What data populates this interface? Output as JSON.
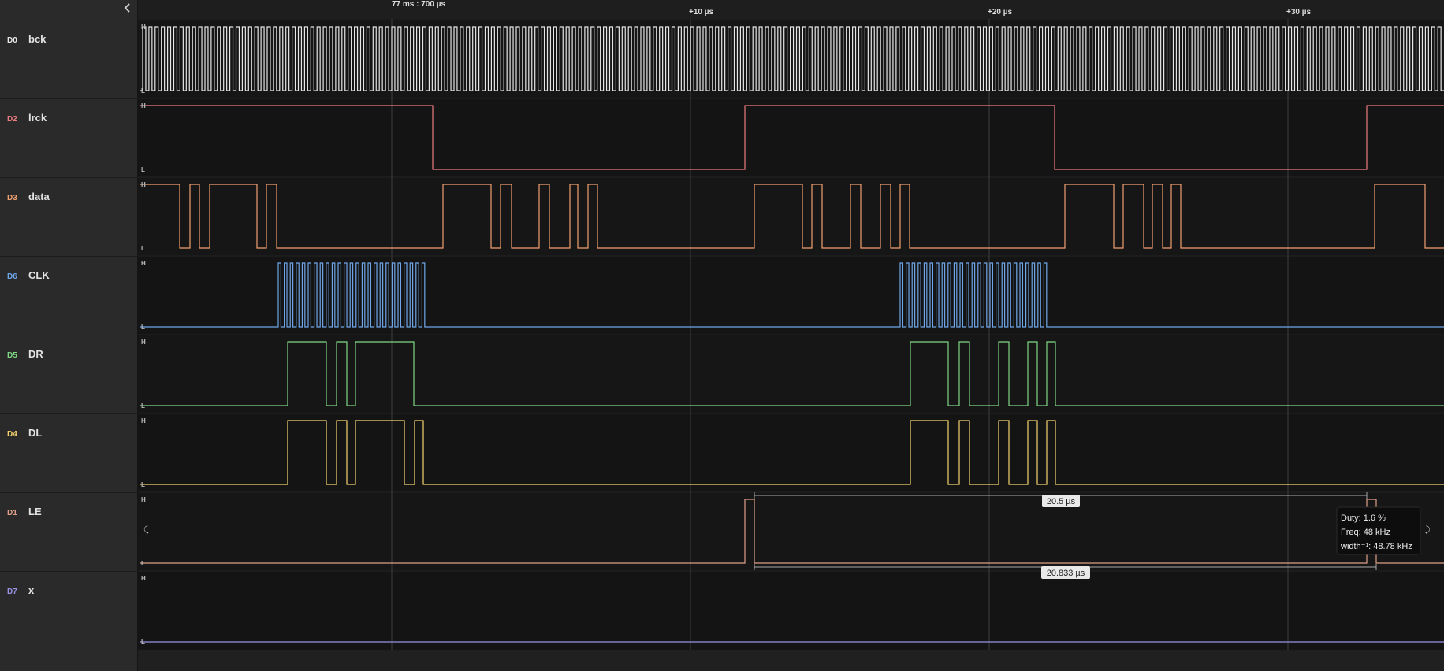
{
  "toolbar": {
    "collapse_icon": "chevron-left-icon"
  },
  "timeline": {
    "ruler_label": "77 ms : 700 µs",
    "ticks": [
      "+10 µs",
      "+20 µs",
      "+30 µs"
    ]
  },
  "level_labels": {
    "high": "H",
    "low": "L"
  },
  "channels": [
    {
      "id": "D0",
      "name": "bck",
      "color": "#e6e6e6"
    },
    {
      "id": "D2",
      "name": "lrck",
      "color": "#ee7c80"
    },
    {
      "id": "D3",
      "name": "data",
      "color": "#f2a071"
    },
    {
      "id": "D6",
      "name": "CLK",
      "color": "#6fa6e9"
    },
    {
      "id": "D5",
      "name": "DR",
      "color": "#7fd884"
    },
    {
      "id": "D4",
      "name": "DL",
      "color": "#f6d56e"
    },
    {
      "id": "D1",
      "name": "LE",
      "color": "#e0a08a"
    },
    {
      "id": "D7",
      "name": "x",
      "color": "#9b93e6"
    }
  ],
  "measurement": {
    "pulse_width": "20.5 µs",
    "period": "20.833 µs",
    "tooltip": {
      "duty": "Duty: 1.6 %",
      "freq": "Freq: 48 kHz",
      "width_inv": "width⁻¹: 48.78 kHz"
    }
  }
}
